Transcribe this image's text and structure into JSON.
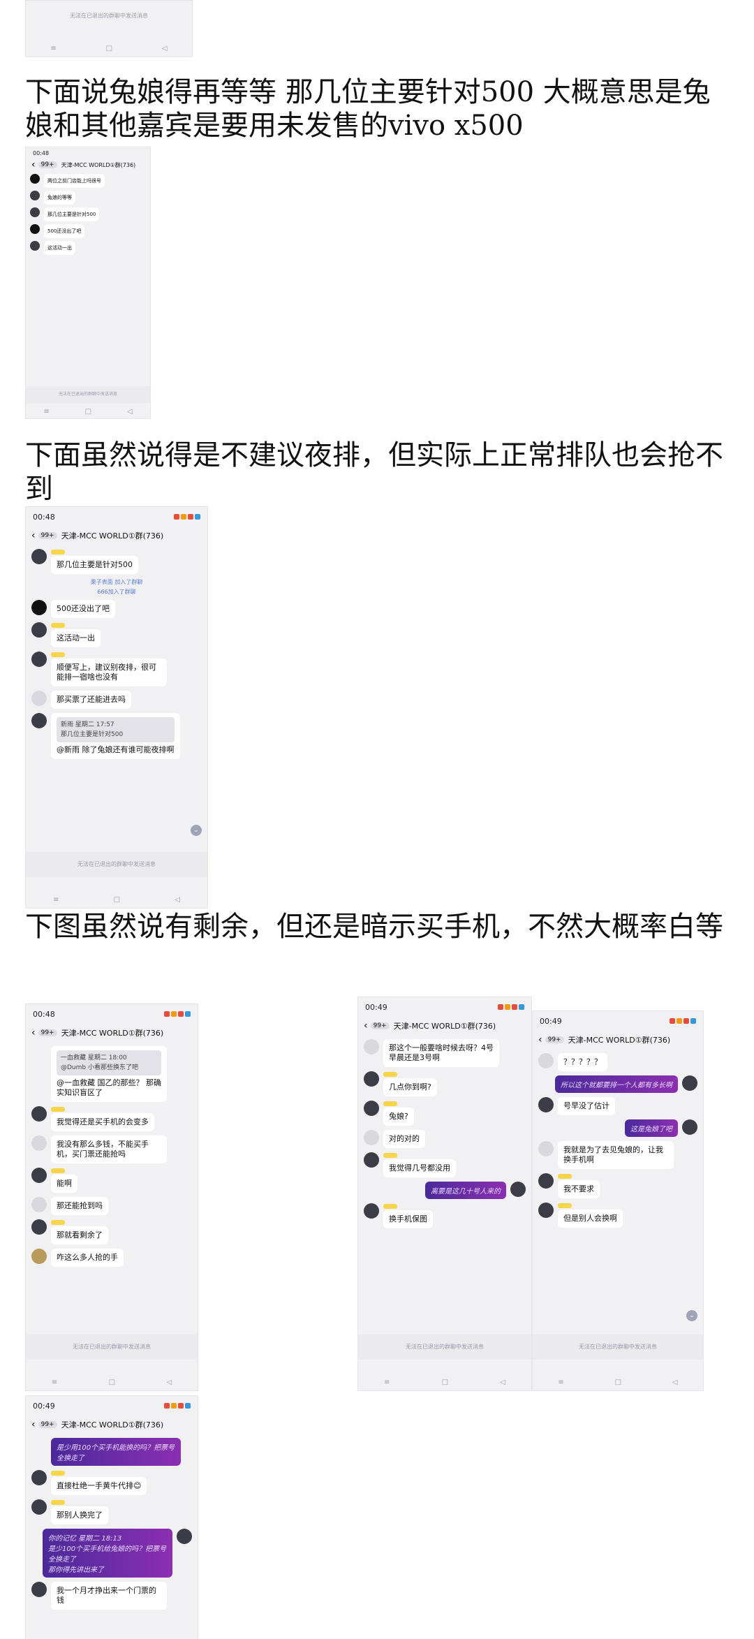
{
  "captions": {
    "c1": "下面说兔娘得再等等 那几位主要针对500  大概意思是兔娘和其他嘉宾是要用未发售的vivo x500",
    "c2": "下面虽然说得是不建议夜排，但实际上正常排队也会抢不到",
    "c3": "下图虽然说有剩余，但还是暗示买手机，不然大概率白等"
  },
  "common": {
    "time_a": "00:48",
    "time_b": "00:49",
    "group_title": "天津-MCC WORLD①群(736)",
    "unread": "99+",
    "input_hint": "无法在已退出的群聊中发送消息",
    "nav_home": "≡",
    "nav_square": "□",
    "nav_back": "◁",
    "back_arrow": "‹"
  },
  "shot0": {
    "input_hint": "无法在已退出的群聊中发送消息"
  },
  "shot1": {
    "m1": "两位之前门店能上吗很号",
    "m2": "兔娘的等等",
    "m3": "那几位主要是针对500",
    "m4": "500还没出了吧",
    "m5": "这活动一出"
  },
  "shot2": {
    "m1": "那几位主要是针对500",
    "sys1": "栗子表面 加入了群聊",
    "sys2": "666加入了群聊",
    "m2": "500还没出了吧",
    "m3": "这活动一出",
    "m4": "顺便写上，建议别夜排，很可能排一宿啥也没有",
    "m5": "那买票了还能进去吗",
    "quote": "新雨 星期二 17:57\n那几位主要是针对500",
    "m6": "@新雨 除了兔娘还有谁可能夜排啊"
  },
  "shot3": {
    "quote": "一血救藏 星期二 18:00\n@Dumb 小看那些换东了吧",
    "m1": "@一血救藏 国乙的那些？ 那确实知识盲区了",
    "m2": "我觉得还是买手机的会变多",
    "m3": "我没有那么多钱，不能买手机，买门票还能抢吗",
    "m4": "能啊",
    "m5": "那还能抢到吗",
    "m6": "那就看剩余了",
    "m7": "咋这么多人抢的手"
  },
  "shot4": {
    "m1": "那这个一般要啥时候去呀？4号早晨还是3号啊",
    "m2": "几点你到啊?",
    "m3": "兔娘?",
    "m4": "对的对的",
    "m5": "我觉得几号都没用",
    "purple": "离要是这几十号人来的",
    "m6": "换手机保图"
  },
  "shot5": {
    "m1": "？？？？？",
    "purple1": "所以这个就都要排一个人都有多长啊",
    "m2": "号早没了估计",
    "purple2": "这是兔娘了吧",
    "m3": "我就是为了去见兔娘的，让我换手机啊",
    "m4": "我不要求",
    "m5": "但是别人会换啊"
  },
  "shot6": {
    "purple1": "是少用100个买手机能换的吗？把票号全换走了",
    "m1": "直接杜绝一手黄牛代排😊",
    "m2": "那别人换完了",
    "purple2": "你的记忆 星期二 18:13\n是少100个买手机给兔娘的吗？把票号全换走了\n那你得先讲出来了",
    "m3": "我一个月才挣出来一个门票的钱"
  }
}
